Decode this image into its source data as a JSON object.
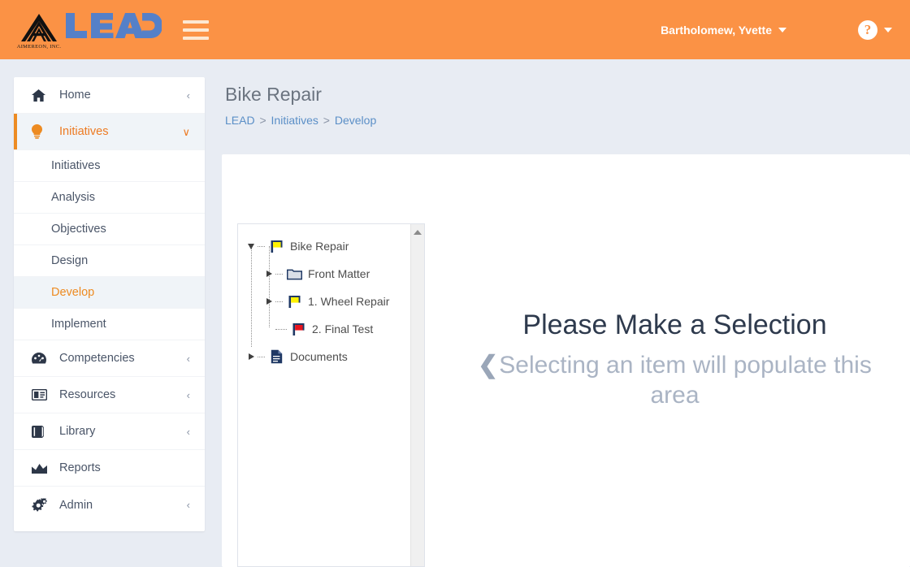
{
  "header": {
    "brand_name": "LEAD",
    "company_name": "AIMEREON, INC.",
    "menu_icon": "hamburger-icon",
    "user_name": "Bartholomew, Yvette",
    "help_glyph": "?",
    "accent_color": "#FB9245",
    "brand_blue": "#5580C8"
  },
  "sidebar": {
    "items": [
      {
        "label": "Home",
        "icon": "home-icon",
        "chevron": "‹",
        "active": false
      },
      {
        "label": "Initiatives",
        "icon": "lightbulb-icon",
        "chevron": "∨",
        "active": true
      },
      {
        "label": "Competencies",
        "icon": "tachometer-icon",
        "chevron": "‹",
        "active": false
      },
      {
        "label": "Resources",
        "icon": "id-card-icon",
        "chevron": "‹",
        "active": false
      },
      {
        "label": "Library",
        "icon": "book-icon",
        "chevron": "‹",
        "active": false
      },
      {
        "label": "Reports",
        "icon": "area-chart-icon",
        "chevron": "",
        "active": false
      },
      {
        "label": "Admin",
        "icon": "cogs-icon",
        "chevron": "‹",
        "active": false
      }
    ],
    "subitems": [
      {
        "label": "Initiatives",
        "active": false
      },
      {
        "label": "Analysis",
        "active": false
      },
      {
        "label": "Objectives",
        "active": false
      },
      {
        "label": "Design",
        "active": false
      },
      {
        "label": "Develop",
        "active": true
      },
      {
        "label": "Implement",
        "active": false
      }
    ],
    "active_color": "#ED8B22"
  },
  "main": {
    "page_title": "Bike Repair",
    "breadcrumb": [
      {
        "label": "LEAD",
        "link": true
      },
      {
        "label": ">",
        "link": false
      },
      {
        "label": "Initiatives",
        "link": true
      },
      {
        "label": ">",
        "link": false
      },
      {
        "label": "Develop",
        "link": true
      }
    ]
  },
  "tree": {
    "nodes": [
      {
        "label": "Bike Repair",
        "icon": "yellow-flag-icon",
        "toggle": "expanded",
        "depth": 0
      },
      {
        "label": "Front Matter",
        "icon": "folder-icon",
        "toggle": "collapsed",
        "depth": 1
      },
      {
        "label": "1. Wheel Repair",
        "icon": "yellow-flag-icon",
        "toggle": "collapsed",
        "depth": 1
      },
      {
        "label": "2. Final Test",
        "icon": "red-flag-icon",
        "toggle": "leaf",
        "depth": 1
      },
      {
        "label": "Documents",
        "icon": "document-icon",
        "toggle": "collapsed",
        "depth": 0
      }
    ],
    "scroll_up_arrow": "scroll-up-arrow"
  },
  "empty_state": {
    "title": "Please Make a Selection",
    "back_chevron": "❮",
    "subtitle": "Selecting an item will populate this area"
  }
}
